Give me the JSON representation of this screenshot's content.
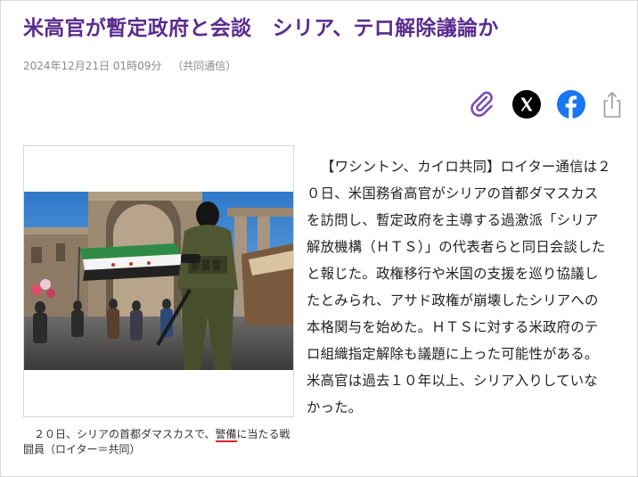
{
  "article": {
    "headline": "米高官が暫定政府と会談　シリア、テロ解除議論か",
    "date": "2024年12月21日 01時09分",
    "source": "（共同通信）",
    "body": "【ワシントン、カイロ共同】ロイター通信は２０日、米国務省高官がシリアの首都ダマスカスを訪問し、暫定政府を主導する過激派「シリア解放機構（ＨＴＳ）」の代表者らと同日会談したと報じた。政権移行や米国の支援を巡り協議したとみられ、アサド政権が崩壊したシリアへの本格関与を始めた。ＨＴＳに対する米政府のテロ組織指定解除も議題に上った可能性がある。米高官は過去１０年以上、シリア入りしていなかった。"
  },
  "photo": {
    "caption_before": "２０日、シリアの首都ダマスカスで、",
    "caption_underlined": "警備",
    "caption_after": "に当たる戦闘員（ロイター＝共同）"
  },
  "share": {
    "icons": [
      "paperclip-icon",
      "x-logo-icon",
      "facebook-icon",
      "share-icon"
    ],
    "colors": {
      "paperclip": "#7a4fb0",
      "x": "#000000",
      "facebook": "#1877f2",
      "share": "#9a9a9a",
      "headline": "#5b2c8f",
      "caption_underline": "#d7262e"
    }
  }
}
